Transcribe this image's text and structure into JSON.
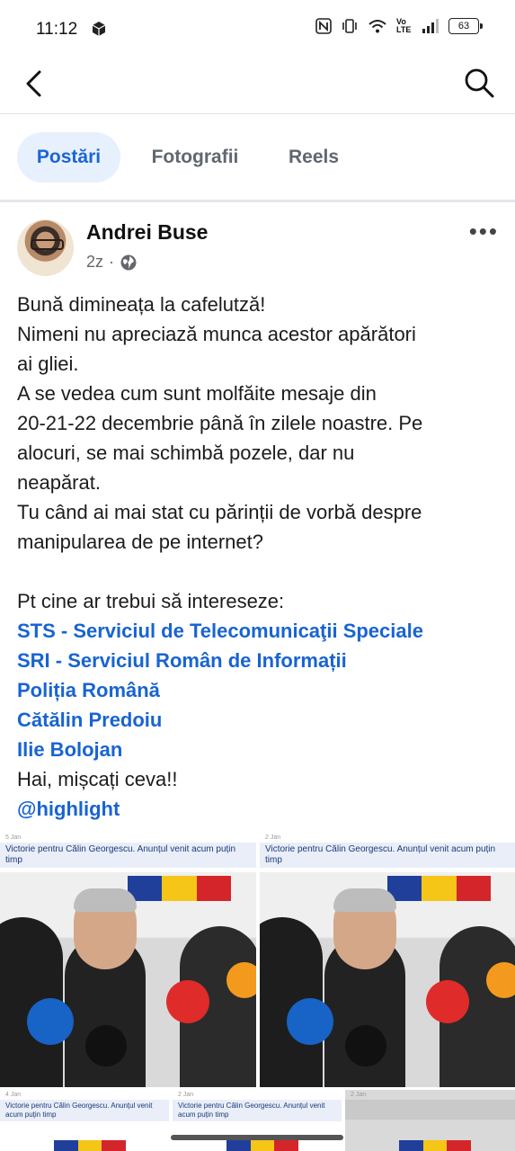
{
  "status": {
    "time": "11:12",
    "battery": "63",
    "net_label": "Vo LTE"
  },
  "nav": {
    "back_icon": "back-arrow-icon",
    "search_icon": "search-icon"
  },
  "tabs": [
    {
      "label": "Postări",
      "active": true
    },
    {
      "label": "Fotografii",
      "active": false
    },
    {
      "label": "Reels",
      "active": false
    }
  ],
  "post": {
    "author": "Andrei Buse",
    "time": "2z",
    "separator": "·",
    "privacy_icon": "globe-icon",
    "lines": [
      "Bună dimineața la cafelutză!",
      "Nimeni nu apreciază munca acestor apărători",
      "ai gliei.",
      "A se vedea cum sunt molfăite mesaje din",
      "20-21-22 decembrie până în zilele noastre. Pe",
      "alocuri, se mai schimbă pozele, dar nu",
      "neapărat.",
      "Tu când ai mai stat cu părinții de vorbă despre",
      "manipularea de pe internet?"
    ],
    "intro": "Pt cine ar trebui să intereseze:",
    "tags": [
      "STS - Serviciul de Telecomunicaţii Speciale",
      "SRI - Serviciul Român de Informații",
      "Poliția Română",
      "Cătălin Predoiu",
      "Ilie Bolojan"
    ],
    "closing": "Hai, mișcați ceva!!",
    "mention": "@highlight"
  },
  "gallery": {
    "top_left": {
      "date": "5 Jan",
      "caption": "Victorie pentru Călin Georgescu. Anunțul venit acum puțin timp"
    },
    "top_right": {
      "date": "2 Jan",
      "caption": "Victorie pentru Călin Georgescu. Anunțul venit acum puțin timp"
    },
    "bottom": [
      {
        "date": "4 Jan",
        "caption": "Victorie pentru Călin Georgescu. Anunțul venit acum puțin timp"
      },
      {
        "date": "2 Jan",
        "caption": "Victorie pentru Călin Georgescu. Anunțul venit acum puțin timp"
      },
      {
        "date": "2 Jan",
        "caption": ""
      }
    ]
  }
}
